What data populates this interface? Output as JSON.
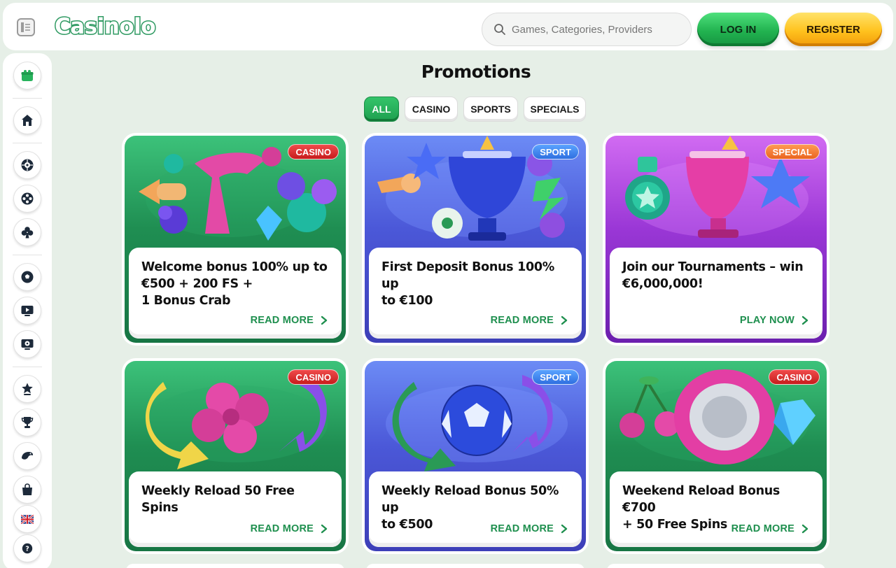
{
  "header": {
    "logo_text": "Casinolo",
    "search_placeholder": "Games, Categories, Providers",
    "login_label": "LOG IN",
    "register_label": "REGISTER"
  },
  "sidebar": {
    "items": [
      {
        "icon": "gift-icon"
      },
      {
        "icon": "home-icon"
      },
      {
        "icon": "roulette-icon"
      },
      {
        "icon": "film-reel-icon"
      },
      {
        "icon": "club-suit-icon"
      },
      {
        "icon": "soccer-ball-icon"
      },
      {
        "icon": "live-tv-icon"
      },
      {
        "icon": "virtual-sports-icon"
      },
      {
        "icon": "star-award-icon"
      },
      {
        "icon": "trophy-icon"
      },
      {
        "icon": "crab-icon"
      },
      {
        "icon": "shopping-bag-icon"
      },
      {
        "icon": "uk-flag-icon"
      },
      {
        "icon": "help-icon"
      }
    ]
  },
  "main": {
    "title": "Promotions",
    "filters": [
      {
        "label": "ALL",
        "active": true
      },
      {
        "label": "CASINO",
        "active": false
      },
      {
        "label": "SPORTS",
        "active": false
      },
      {
        "label": "SPECIALS",
        "active": false
      }
    ],
    "cards": [
      {
        "badge": "CASINO",
        "theme": "casino",
        "title": "Welcome bonus 100% up to\n€500 + 200 FS +\n1 Bonus Crab",
        "cta": "READ MORE"
      },
      {
        "badge": "SPORT",
        "theme": "sport",
        "title": "First Deposit Bonus 100% up\nto €100",
        "cta": "READ MORE"
      },
      {
        "badge": "SPECIAL",
        "theme": "special",
        "title": "Join our Tournaments – win\n€6,000,000!",
        "cta": "PLAY NOW"
      },
      {
        "badge": "CASINO",
        "theme": "casino",
        "title": "Weekly Reload 50 Free Spins",
        "cta": "READ MORE"
      },
      {
        "badge": "SPORT",
        "theme": "sport",
        "title": "Weekly Reload Bonus 50% up\nto €500",
        "cta": "READ MORE"
      },
      {
        "badge": "CASINO",
        "theme": "casino",
        "title": "Weekend Reload Bonus €700\n+ 50 Free Spins",
        "cta": "READ MORE"
      }
    ]
  },
  "colors": {
    "page_bg": "#e6efe7",
    "brand_green": "#2f9a62",
    "login_green": "#22b350",
    "register_yellow": "#ffc21e",
    "cta_green": "#1e8f4e",
    "casino_card": "#1f8e52",
    "sport_card": "#4b58d8",
    "special_card": "#9a37d6"
  }
}
